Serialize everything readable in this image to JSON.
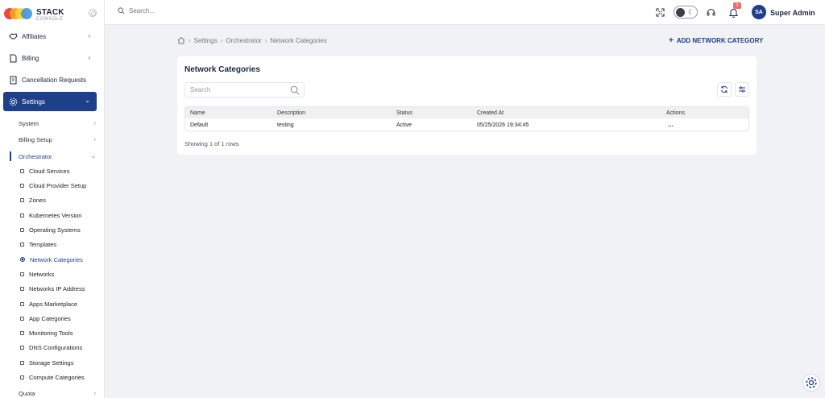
{
  "app": {
    "logo_title": "STACK",
    "logo_subtitle": "CONSOLE"
  },
  "sidebar": {
    "main_items": [
      {
        "label": "Affiliates",
        "icon": "handshake-icon"
      },
      {
        "label": "Billing",
        "icon": "document-icon"
      },
      {
        "label": "Cancellation Requests",
        "icon": "clipboard-icon"
      },
      {
        "label": "Settings",
        "icon": "gear-icon"
      }
    ],
    "sub_items": [
      {
        "label": "System"
      },
      {
        "label": "Billing Setup"
      },
      {
        "label": "Orchestrator"
      }
    ],
    "leaf_items": [
      {
        "label": "Cloud Services"
      },
      {
        "label": "Cloud Provider Setup"
      },
      {
        "label": "Zones"
      },
      {
        "label": "Kubernetes Version"
      },
      {
        "label": "Operating Systems"
      },
      {
        "label": "Templates"
      },
      {
        "label": "Network Categories"
      },
      {
        "label": "Networks"
      },
      {
        "label": "Networks IP Address"
      },
      {
        "label": "Apps Marketplace"
      },
      {
        "label": "App Categories"
      },
      {
        "label": "Monitoring Tools"
      },
      {
        "label": "DNS Configurations"
      },
      {
        "label": "Storage Settings"
      },
      {
        "label": "Compute Categories"
      }
    ],
    "bottom_item": {
      "label": "Quota"
    }
  },
  "topbar": {
    "search_placeholder": "Search...",
    "notification_count": "3",
    "avatar_initials": "SA",
    "user_name": "Super Admin"
  },
  "breadcrumb": {
    "items": [
      "Settings",
      "Orchestrator",
      "Network Categories"
    ]
  },
  "actions": {
    "add_label": "ADD NETWORK CATEGORY"
  },
  "card": {
    "title": "Network Categories",
    "search_placeholder": "Search",
    "columns": [
      "Name",
      "Description",
      "Status",
      "Created At",
      "Actions"
    ],
    "rows": [
      {
        "name": "Default",
        "description": "testing",
        "status": "Active",
        "created_at": "05/25/2026 19:34:45",
        "actions": "…"
      }
    ],
    "footer": "Showing 1 of 1 rows"
  },
  "colors": {
    "primary": "#1e3f8a",
    "background": "#f1f2f5",
    "badge": "#f26b6b"
  }
}
